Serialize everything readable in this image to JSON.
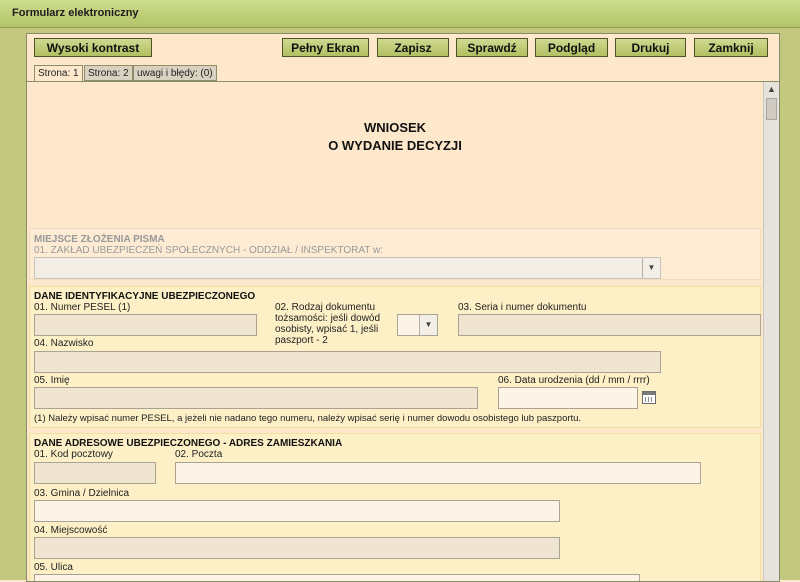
{
  "window": {
    "title": "Formularz elektroniczny"
  },
  "toolbar": {
    "high_contrast": "Wysoki kontrast",
    "fullscreen": "Pełny Ekran",
    "save": "Zapisz",
    "check": "Sprawdź",
    "preview": "Podgląd",
    "print": "Drukuj",
    "close": "Zamknij"
  },
  "tabs": [
    "Strona: 1",
    "Strona: 2",
    "uwagi i błędy: (0)"
  ],
  "form": {
    "title_line1": "WNIOSEK",
    "title_line2": "O WYDANIE DECYZJI",
    "place": {
      "title": "MIEJSCE ZŁOŻENIA PISMA",
      "field01": "01. ZAKŁAD UBEZPIECZEŃ SPOŁECZNYCH - ODDZIAŁ / INSPEKTORAT w:"
    },
    "identity": {
      "title": "DANE IDENTYFIKACYJNE UBEZPIECZONEGO",
      "pesel": "01. Numer PESEL (1)",
      "doc_type_lines": [
        "02. Rodzaj dokumentu",
        "tożsamości: jeśli dowód",
        "osobisty, wpisać 1, jeśli",
        "paszport - 2"
      ],
      "doc_number": "03. Seria i numer dokumentu",
      "surname": "04. Nazwisko",
      "first_name": "05. Imię",
      "birth_date": "06. Data urodzenia (dd / mm / rrrr)",
      "note": "(1) Należy wpisać numer PESEL, a jeżeli nie nadano tego numeru, należy wpisać serię i numer dowodu osobistego lub paszportu."
    },
    "address": {
      "title": "DANE ADRESOWE UBEZPIECZONEGO - ADRES ZAMIESZKANIA",
      "postal_code": "01. Kod pocztowy",
      "post_office": "02. Poczta",
      "municipality": "03. Gmina / Dzielnica",
      "city": "04. Miejscowość",
      "street": "05. Ulica"
    }
  }
}
